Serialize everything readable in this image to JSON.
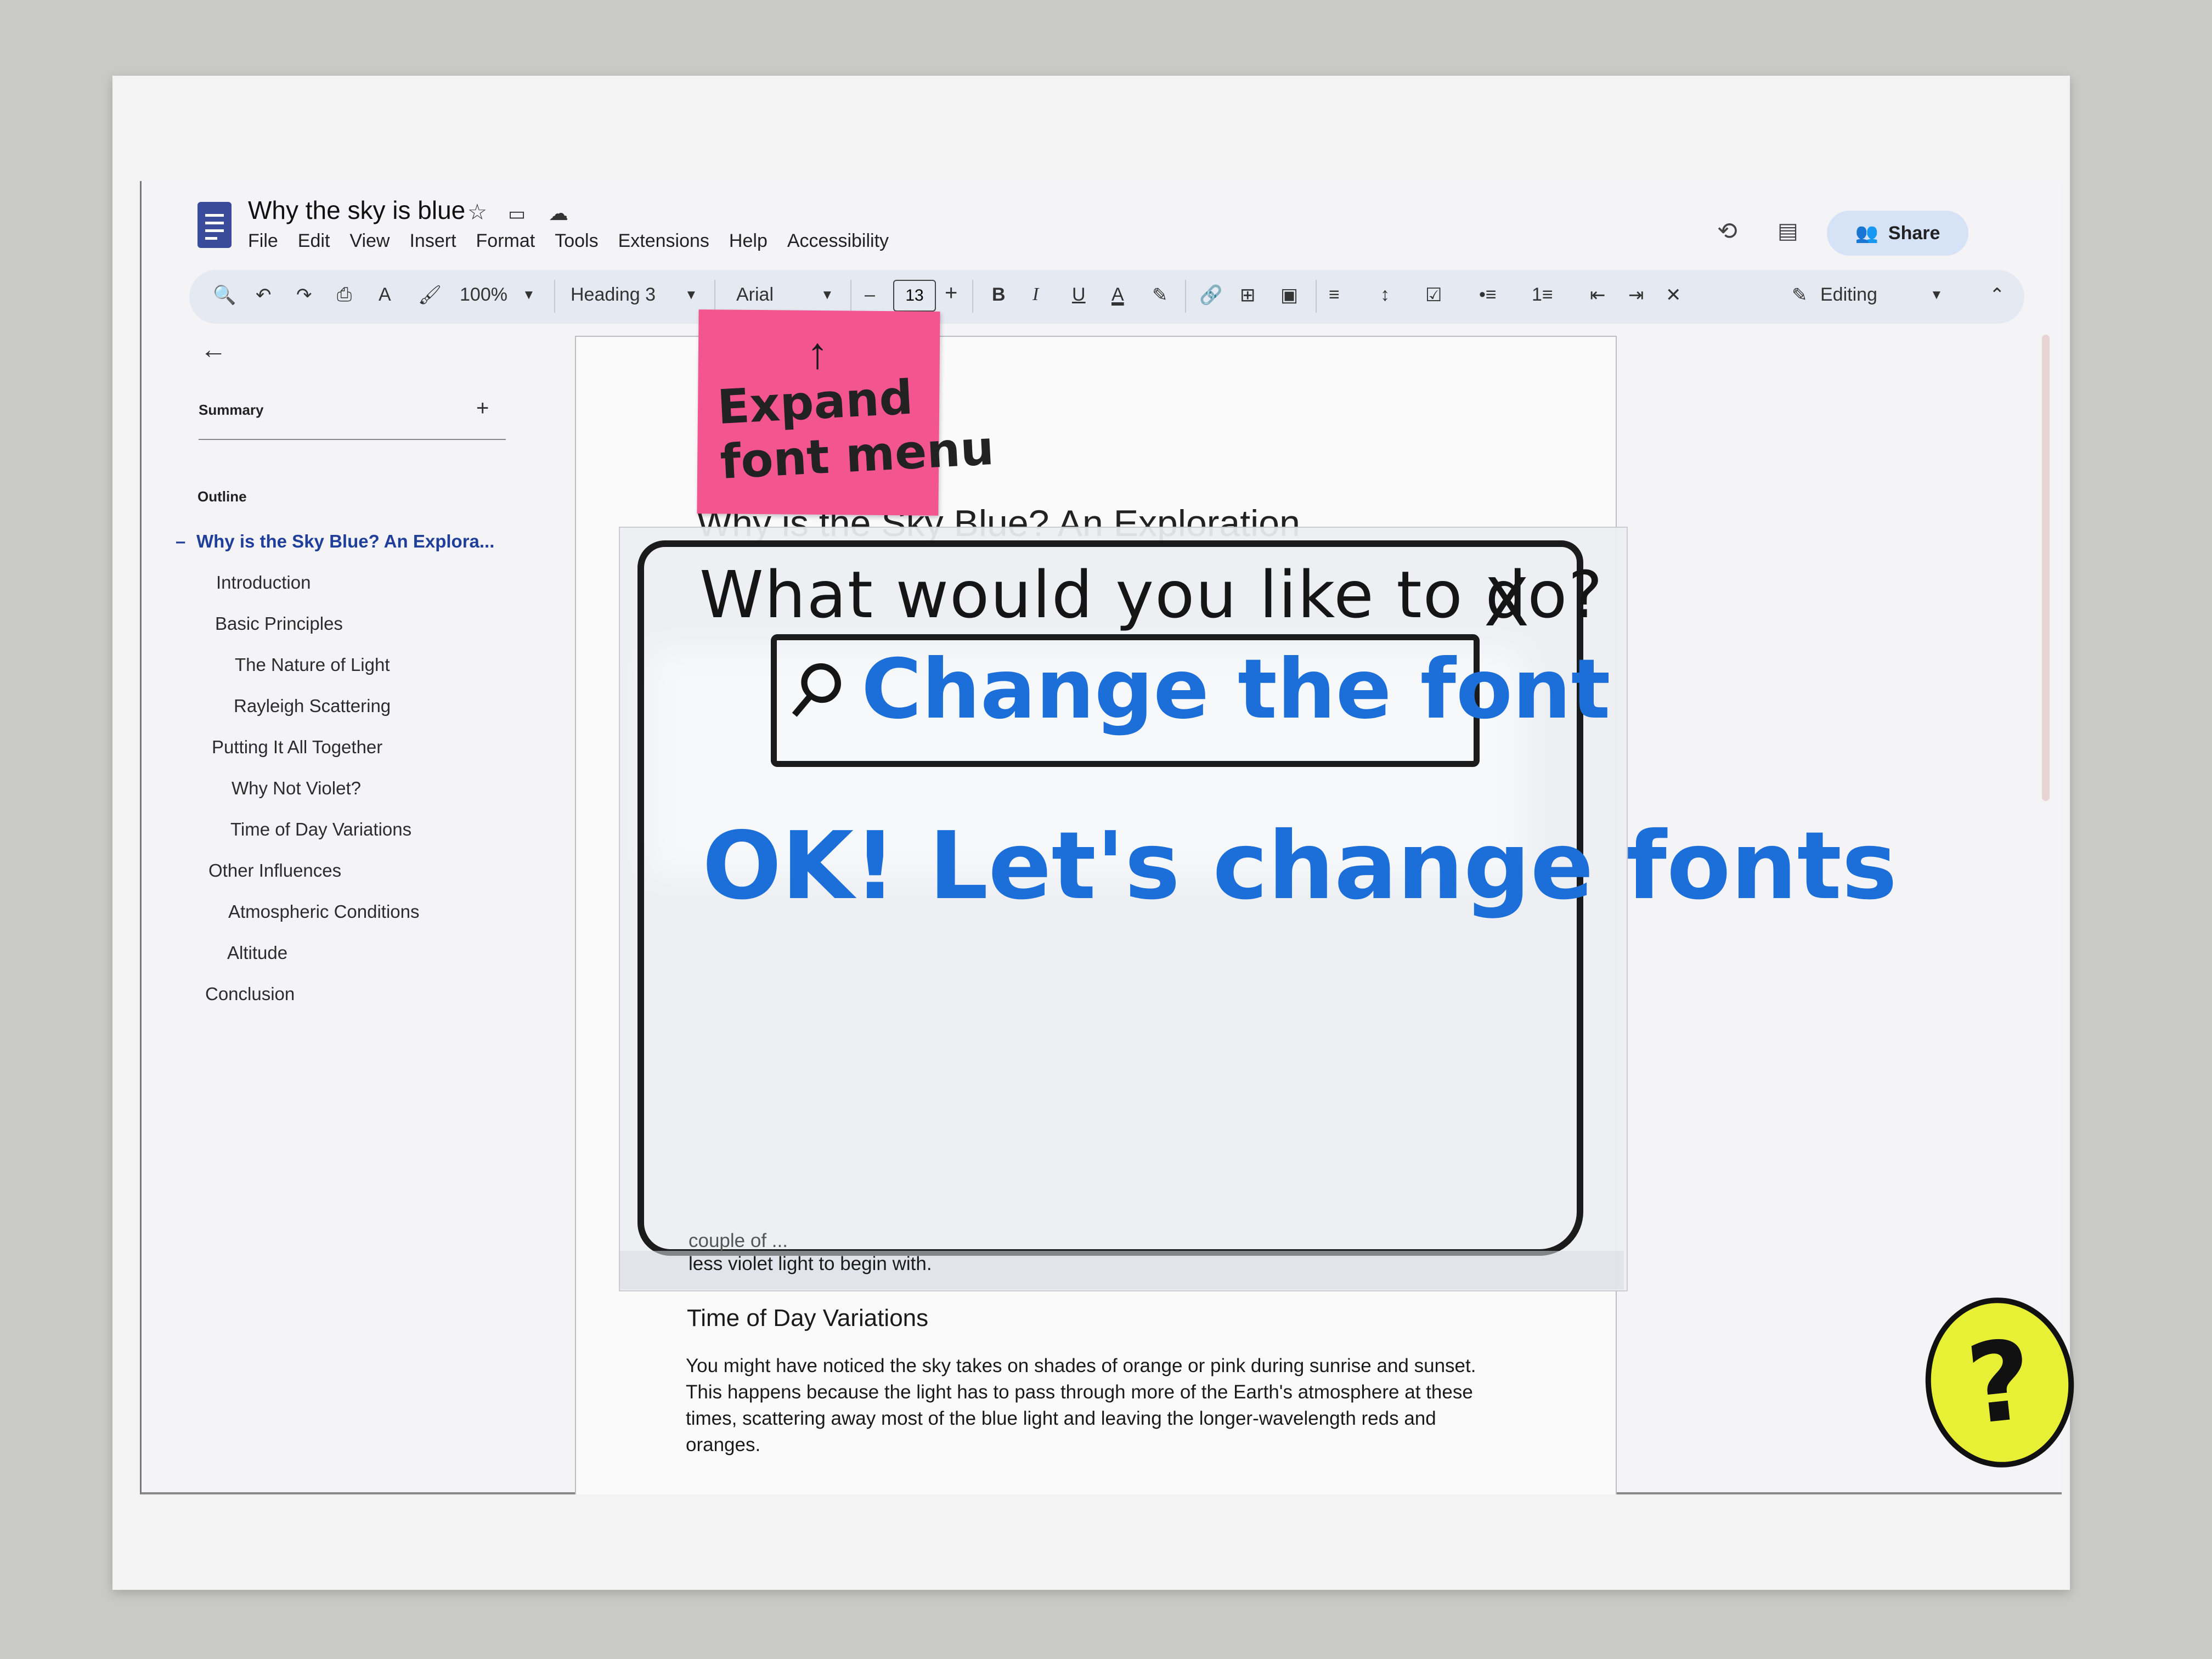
{
  "header": {
    "doc_title": "Why the sky is blue",
    "menu": [
      "File",
      "Edit",
      "View",
      "Insert",
      "Format",
      "Tools",
      "Extensions",
      "Help",
      "Accessibility"
    ],
    "share_label": "Share"
  },
  "toolbar": {
    "zoom": "100%",
    "style": "Heading 3",
    "font": "Arial",
    "font_size": "13",
    "minus": "–",
    "plus": "+",
    "mode": "Editing"
  },
  "sidebar": {
    "summary_label": "Summary",
    "summary_add": "+",
    "outline_label": "Outline",
    "items": [
      {
        "label": "Why is the Sky Blue? An Explora..."
      },
      {
        "label": "Introduction"
      },
      {
        "label": "Basic Principles"
      },
      {
        "label": "The Nature of Light"
      },
      {
        "label": "Rayleigh Scattering"
      },
      {
        "label": "Putting It All Together"
      },
      {
        "label": "Why Not Violet?"
      },
      {
        "label": "Time of Day Variations"
      },
      {
        "label": "Other Influences"
      },
      {
        "label": "Atmospheric Conditions"
      },
      {
        "label": "Altitude"
      },
      {
        "label": "Conclusion"
      }
    ]
  },
  "page": {
    "title_partial": "Why is the Sky Blue? An Exploration",
    "para_fragment_1": "couple of ...",
    "para_fragment_2": "less violet light to begin with.",
    "section_heading": "Time of Day Variations",
    "section_lines": [
      "You might have noticed the sky takes on shades of orange or pink during sunrise and sunset.",
      "This happens because the light has to pass through more of the Earth's atmosphere at these",
      "times, scattering away most of the blue light and leaving the longer-wavelength reds and",
      "oranges."
    ]
  },
  "overlay": {
    "prompt": "What would you like to do?",
    "close": "X",
    "query": "Change the font",
    "reply": "OK! Let's change fonts"
  },
  "sticky_note": {
    "arrow": "↑",
    "line1": "Expand",
    "line2": "font menu"
  },
  "help_sticker": "?",
  "colors": {
    "accent": "#1f3f9a",
    "share_bg": "#d6e2f5",
    "sticky": "#f3558f",
    "handwriting_blue": "#1c6fd8",
    "help_yellow": "#e8f035"
  }
}
